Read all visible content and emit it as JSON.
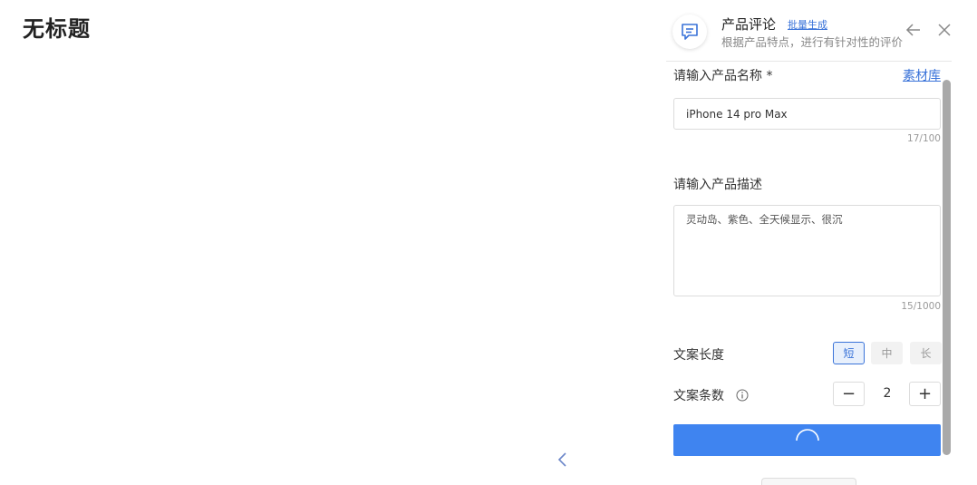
{
  "page": {
    "title": "无标题"
  },
  "panel": {
    "header": {
      "icon": "comment-icon",
      "title": "产品评论",
      "batch_link": "批量生成",
      "subtitle": "根据产品特点，进行有针对性的评价"
    },
    "product_name": {
      "label": "请输入产品名称 *",
      "library_link": "素材库",
      "value": "iPhone 14 pro Max",
      "counter": "17/100"
    },
    "product_desc": {
      "label": "请输入产品描述",
      "value": "灵动岛、紫色、全天候显示、很沉",
      "counter": "15/1000"
    },
    "length": {
      "label": "文案长度",
      "options": [
        "短",
        "中",
        "长"
      ],
      "selected": "短"
    },
    "count": {
      "label": "文案条数",
      "value": "2",
      "minus": "−",
      "plus": "+"
    },
    "submit": {
      "state": "loading"
    }
  },
  "colors": {
    "accent": "#3f84f0",
    "link": "#3a73d9"
  }
}
